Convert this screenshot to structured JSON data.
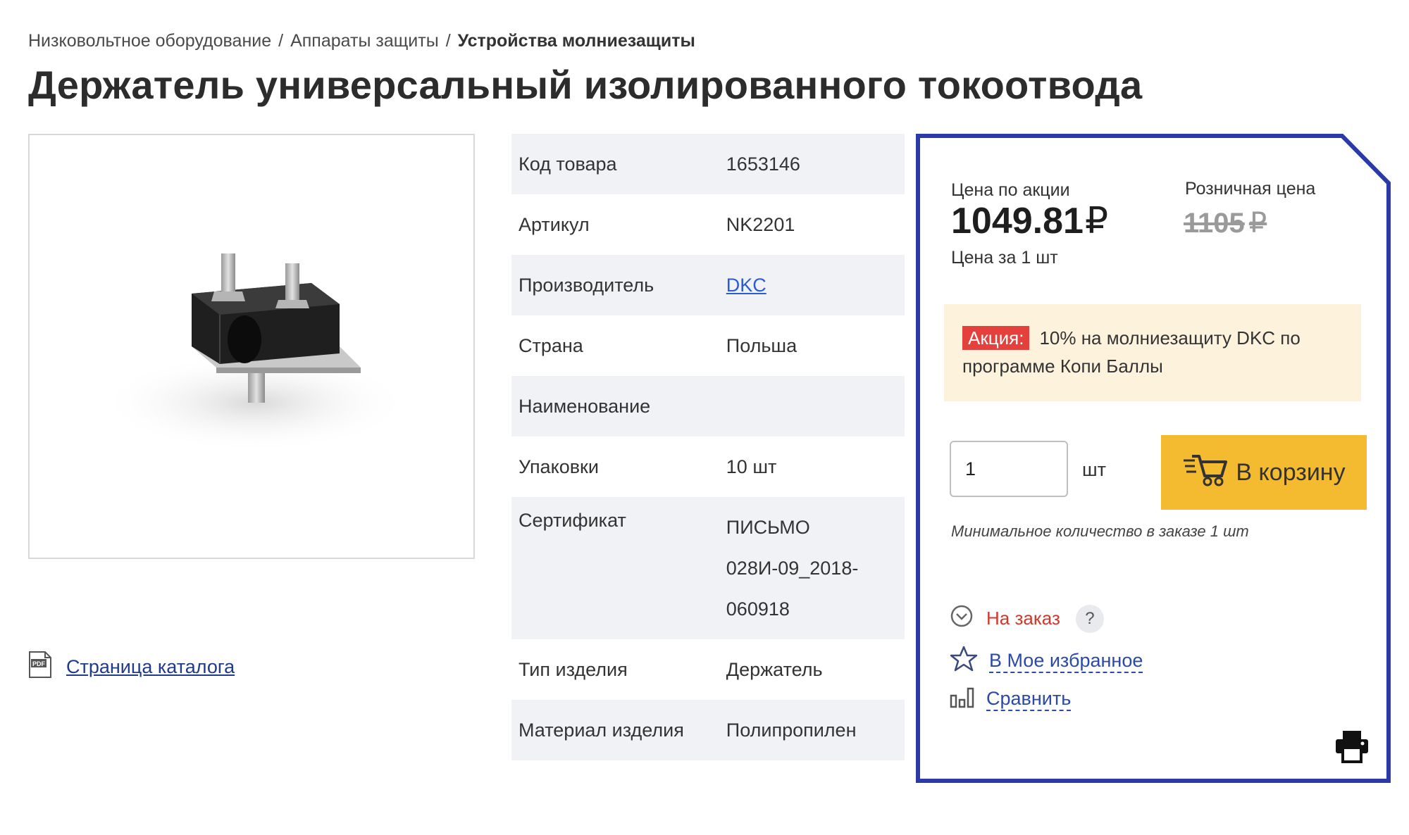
{
  "breadcrumb": {
    "items": [
      "Низковольтное оборудование",
      "Аппараты защиты"
    ],
    "current": "Устройства молниезащиты",
    "separator": "/"
  },
  "page_title": "Держатель универсальный изолированного токоотвода",
  "catalog_link": {
    "label": "Страница каталога",
    "icon": "pdf-icon"
  },
  "specs": {
    "rows": [
      {
        "key": "Код товара",
        "value": "1653146"
      },
      {
        "key": "Артикул",
        "value": "NK2201"
      },
      {
        "key": "Производитель",
        "value": "DKC"
      },
      {
        "key": "Страна",
        "value": "Польша"
      },
      {
        "key": "Наименование",
        "value": ""
      },
      {
        "key": "Упаковки",
        "value": "10 шт"
      },
      {
        "key": "Сертификат",
        "value": "ПИСЬМО 028И-09_2018-060918"
      },
      {
        "key": "Тип изделия",
        "value": "Держатель"
      },
      {
        "key": "Материал изделия",
        "value": "Полипропилен"
      }
    ]
  },
  "price": {
    "promo_label": "Цена по акции",
    "promo_value": "1049.81",
    "currency": "₽",
    "per_unit": "Цена за 1 шт",
    "retail_label": "Розничная цена",
    "retail_value": "1105"
  },
  "promo": {
    "tag": "Акция:",
    "text": "10% на молниезащиту DKC по программе Копи Баллы"
  },
  "order": {
    "quantity": "1",
    "unit": "шт",
    "cart_button": "В корзину",
    "min_qty": "Минимальное количество в заказе 1 шт"
  },
  "availability": {
    "status": "На заказ",
    "help": "?"
  },
  "actions": {
    "favorite": "В Мое избранное",
    "compare": "Сравнить"
  },
  "colors": {
    "panel_border": "#2a3aa8",
    "cart_button": "#f4bb30",
    "promo_bg": "#fdf3dd",
    "promo_tag": "#e4413c",
    "status_red": "#d3372c",
    "link_blue": "#2a49a8"
  }
}
